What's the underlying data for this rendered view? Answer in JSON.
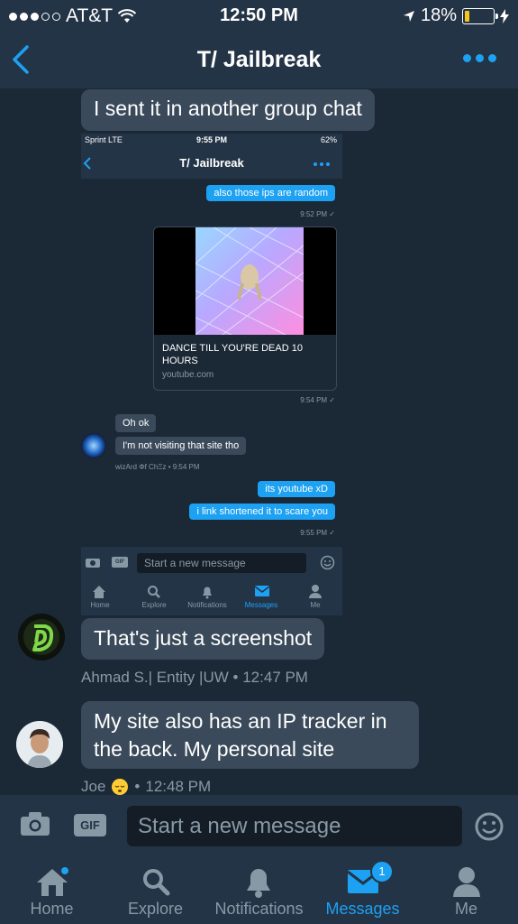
{
  "status_bar": {
    "carrier": "AT&T",
    "time": "12:50 PM",
    "battery": "18%",
    "battery_level": 0.18
  },
  "nav": {
    "title": "T/ Jailbreak"
  },
  "messages": [
    {
      "text": "I sent it in another group chat"
    },
    {
      "text": "That's just a screenshot",
      "sender": "Ahmad S.| Entity |UW",
      "time": "12:47 PM"
    },
    {
      "text": "My site also has an IP tracker in the back. My personal site",
      "sender": "Joe",
      "time": "12:48 PM"
    }
  ],
  "embedded": {
    "status": {
      "carrier": "Sprint  LTE",
      "time": "9:55 PM",
      "battery": "62%"
    },
    "title": "T/ Jailbreak",
    "msg1": "also those ips are random",
    "meta1": "9:52 PM ✓",
    "card_title": "DANCE TILL YOU'RE DEAD 10 HOURS",
    "card_domain": "youtube.com",
    "meta2": "9:54 PM ✓",
    "reply1": "Oh ok",
    "reply2": "I'm not visiting that site tho",
    "reply_meta": "wizArd Φf ChΞz • 9:54 PM",
    "msg2": "its youtube xD",
    "msg3": "i link shortened it to scare you",
    "meta3": "9:55 PM ✓",
    "placeholder": "Start a new message",
    "gif": "GIF",
    "tabs": [
      "Home",
      "Explore",
      "Notifications",
      "Messages",
      "Me"
    ]
  },
  "compose": {
    "placeholder": "Start a new message",
    "gif_label": "GIF"
  },
  "tabbar": {
    "tabs": [
      "Home",
      "Explore",
      "Notifications",
      "Messages",
      "Me"
    ],
    "messages_badge": "1",
    "active": "Messages"
  },
  "colors": {
    "accent": "#1da1f2",
    "background": "#1b2836",
    "bubble": "#3a4a5b",
    "bar": "#243447"
  }
}
